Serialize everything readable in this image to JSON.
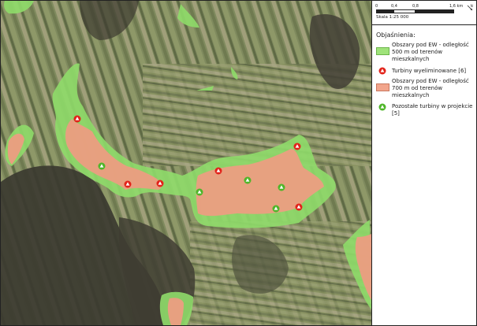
{
  "scale": {
    "ticks": [
      "0",
      "0,4",
      "0,8",
      "1,6 km"
    ],
    "label": "Skala 1:25 000",
    "north_icon": "north-arrow-icon"
  },
  "legend": {
    "title": "Objaśnienia:",
    "items": [
      {
        "label": "Obszary pod EW - odległość 500 m od terenów mieszkalnych",
        "color": "#9fe37a",
        "symbol": "green-area-swatch"
      },
      {
        "label": "Turbiny wyeliminowane [6]",
        "color": "#e2231a",
        "symbol": "red-turbine-triangle-icon"
      },
      {
        "label": "Obszary pod EW - odległość 700 m od terenów mieszkalnych",
        "color": "#f2a58c",
        "symbol": "salmon-area-swatch"
      },
      {
        "label": "Pozostałe turbiny w projekcie [5]",
        "color": "#4fb62a",
        "symbol": "green-turbine-triangle-icon"
      }
    ]
  },
  "colors": {
    "zone_500": "#8fdc6a",
    "zone_700": "#ef9c82",
    "turbine_removed": "#e2231a",
    "turbine_remaining": "#4fb62a"
  }
}
